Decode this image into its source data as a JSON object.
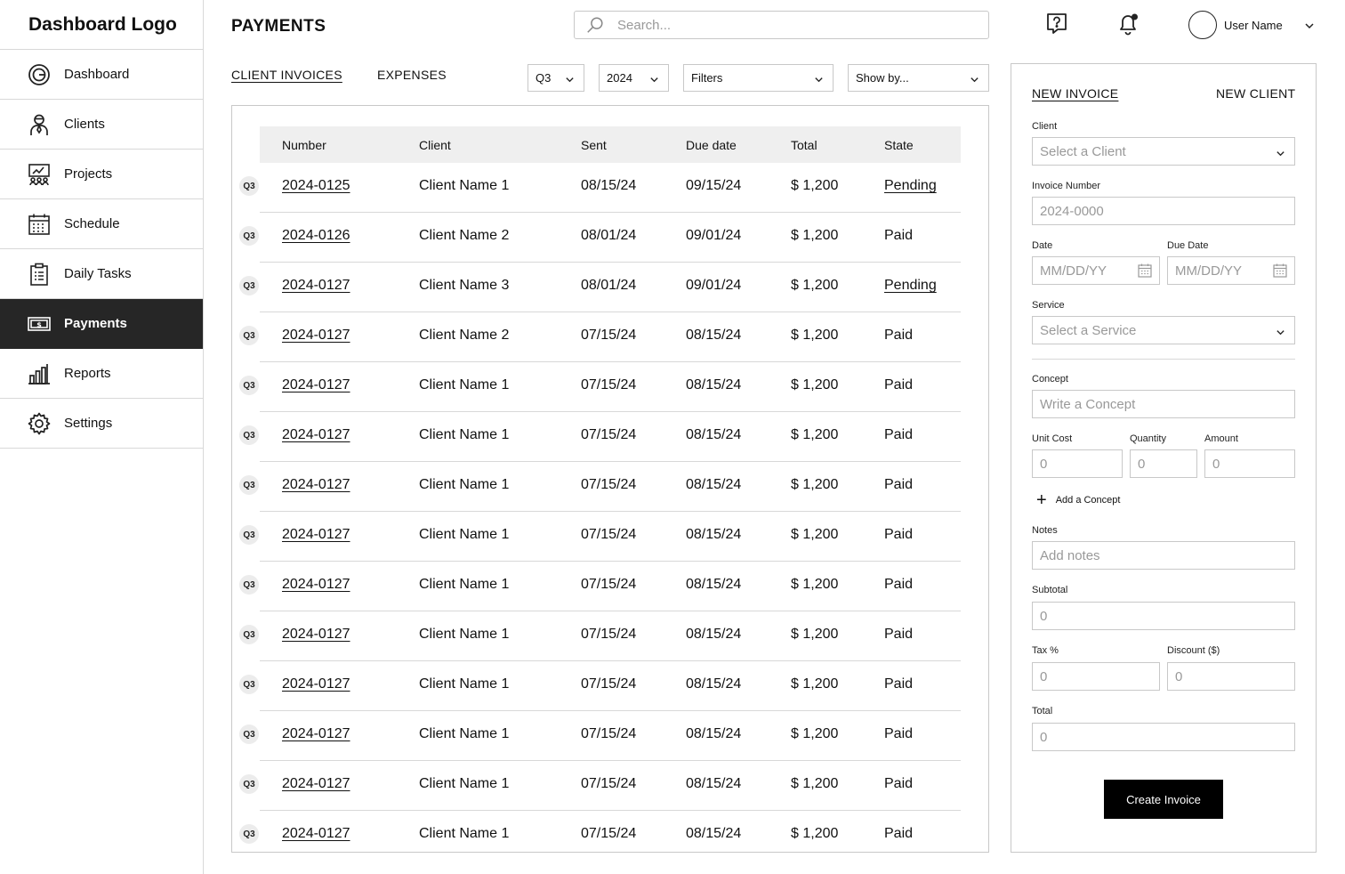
{
  "sidebar": {
    "logo": "Dashboard Logo",
    "items": [
      {
        "label": "Dashboard",
        "icon": "dashboard-icon"
      },
      {
        "label": "Clients",
        "icon": "clients-icon"
      },
      {
        "label": "Projects",
        "icon": "projects-icon"
      },
      {
        "label": "Schedule",
        "icon": "calendar-icon"
      },
      {
        "label": "Daily Tasks",
        "icon": "clipboard-icon"
      },
      {
        "label": "Payments",
        "icon": "payments-icon",
        "active": true
      },
      {
        "label": "Reports",
        "icon": "bar-chart-icon"
      },
      {
        "label": "Settings",
        "icon": "gear-icon"
      }
    ]
  },
  "header": {
    "title": "PAYMENTS",
    "search_placeholder": "Search...",
    "user_name": "User Name"
  },
  "tabs": {
    "invoices": "CLIENT INVOICES",
    "expenses": "EXPENSES"
  },
  "filters": {
    "quarter": "Q3",
    "year": "2024",
    "filters": "Filters",
    "show_by": "Show by..."
  },
  "table": {
    "headers": {
      "number": "Number",
      "client": "Client",
      "sent": "Sent",
      "due": "Due date",
      "total": "Total",
      "state": "State"
    },
    "rows": [
      {
        "q": "Q3",
        "number": "2024-0125",
        "client": "Client Name 1",
        "sent": "08/15/24",
        "due": "09/15/24",
        "total": "$ 1,200",
        "state": "Pending"
      },
      {
        "q": "Q3",
        "number": "2024-0126",
        "client": "Client Name 2",
        "sent": "08/01/24",
        "due": "09/01/24",
        "total": "$ 1,200",
        "state": "Paid"
      },
      {
        "q": "Q3",
        "number": "2024-0127",
        "client": "Client Name 3",
        "sent": "08/01/24",
        "due": "09/01/24",
        "total": "$ 1,200",
        "state": "Pending"
      },
      {
        "q": "Q3",
        "number": "2024-0127",
        "client": "Client Name 2",
        "sent": "07/15/24",
        "due": "08/15/24",
        "total": "$ 1,200",
        "state": "Paid"
      },
      {
        "q": "Q3",
        "number": "2024-0127",
        "client": "Client Name 1",
        "sent": "07/15/24",
        "due": "08/15/24",
        "total": "$ 1,200",
        "state": "Paid"
      },
      {
        "q": "Q3",
        "number": "2024-0127",
        "client": "Client Name 1",
        "sent": "07/15/24",
        "due": "08/15/24",
        "total": "$ 1,200",
        "state": "Paid"
      },
      {
        "q": "Q3",
        "number": "2024-0127",
        "client": "Client Name 1",
        "sent": "07/15/24",
        "due": "08/15/24",
        "total": "$ 1,200",
        "state": "Paid"
      },
      {
        "q": "Q3",
        "number": "2024-0127",
        "client": "Client Name 1",
        "sent": "07/15/24",
        "due": "08/15/24",
        "total": "$ 1,200",
        "state": "Paid"
      },
      {
        "q": "Q3",
        "number": "2024-0127",
        "client": "Client Name 1",
        "sent": "07/15/24",
        "due": "08/15/24",
        "total": "$ 1,200",
        "state": "Paid"
      },
      {
        "q": "Q3",
        "number": "2024-0127",
        "client": "Client Name 1",
        "sent": "07/15/24",
        "due": "08/15/24",
        "total": "$ 1,200",
        "state": "Paid"
      },
      {
        "q": "Q3",
        "number": "2024-0127",
        "client": "Client Name 1",
        "sent": "07/15/24",
        "due": "08/15/24",
        "total": "$ 1,200",
        "state": "Paid"
      },
      {
        "q": "Q3",
        "number": "2024-0127",
        "client": "Client Name 1",
        "sent": "07/15/24",
        "due": "08/15/24",
        "total": "$ 1,200",
        "state": "Paid"
      },
      {
        "q": "Q3",
        "number": "2024-0127",
        "client": "Client Name 1",
        "sent": "07/15/24",
        "due": "08/15/24",
        "total": "$ 1,200",
        "state": "Paid"
      },
      {
        "q": "Q3",
        "number": "2024-0127",
        "client": "Client Name 1",
        "sent": "07/15/24",
        "due": "08/15/24",
        "total": "$ 1,200",
        "state": "Paid"
      }
    ]
  },
  "form": {
    "tab_new_invoice": "NEW INVOICE",
    "tab_new_client": "NEW CLIENT",
    "client_label": "Client",
    "client_placeholder": "Select a Client",
    "invoice_number_label": "Invoice Number",
    "invoice_number_placeholder": "2024-0000",
    "date_label": "Date",
    "date_placeholder": "MM/DD/YY",
    "due_date_label": "Due Date",
    "due_date_placeholder": "MM/DD/YY",
    "service_label": "Service",
    "service_placeholder": "Select a Service",
    "concept_label": "Concept",
    "concept_placeholder": "Write a Concept",
    "unit_cost_label": "Unit Cost",
    "quantity_label": "Quantity",
    "amount_label": "Amount",
    "zero": "0",
    "add_concept": "Add a Concept",
    "notes_label": "Notes",
    "notes_placeholder": "Add notes",
    "subtotal_label": "Subtotal",
    "tax_label": "Tax %",
    "discount_label": "Discount ($)",
    "total_label": "Total",
    "create_button": "Create Invoice"
  }
}
